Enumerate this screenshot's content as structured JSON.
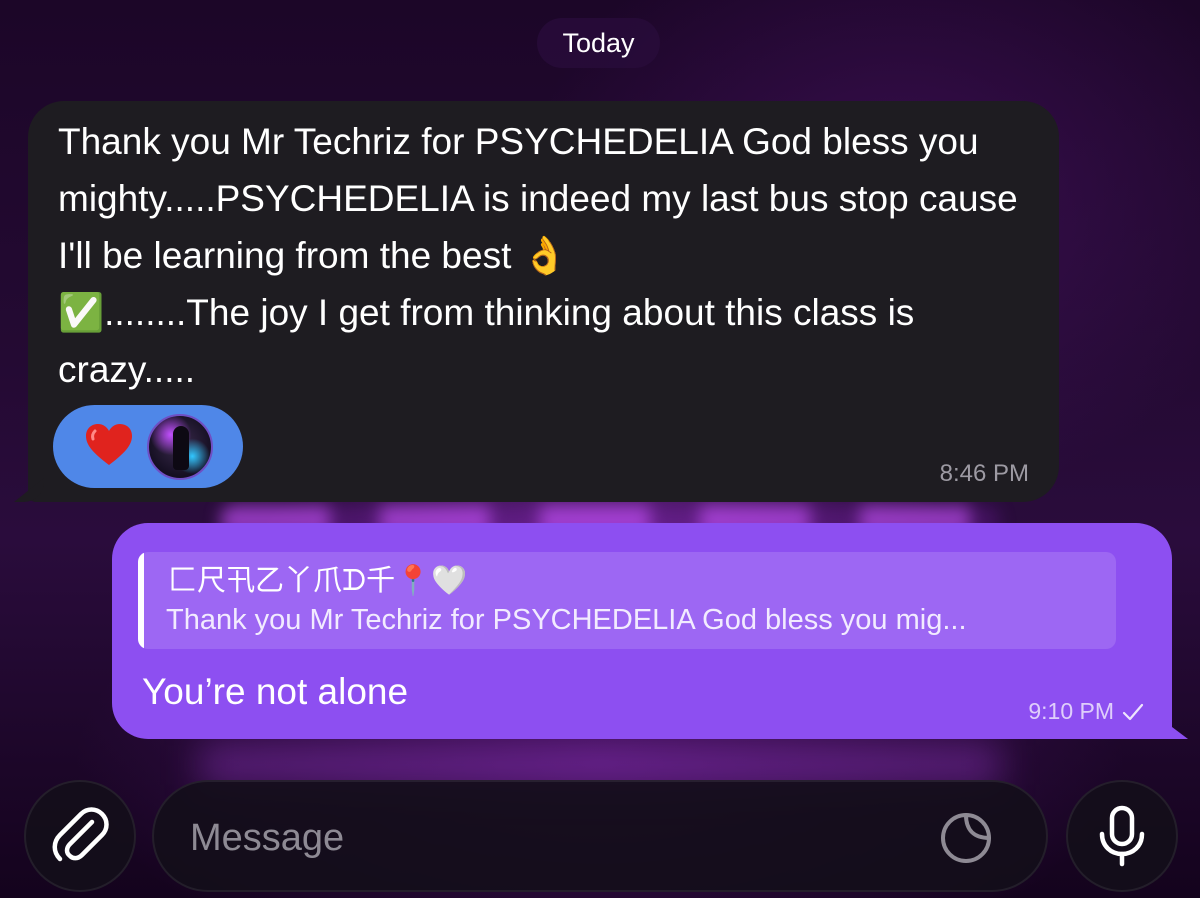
{
  "date_separator": "Today",
  "incoming": {
    "text": "Thank you Mr Techriz for PSYCHEDELIA God bless you mighty.....PSYCHEDELIA is indeed my last bus stop cause I'll be learning from the best 👌\n✅........The joy I get from thinking about this class is crazy.....",
    "reaction_emoji": "❤️",
    "time": "8:46 PM"
  },
  "outgoing": {
    "reply_to_name": "匚尺卂乙丫爪ᗪ千📍🤍",
    "reply_to_text": "Thank you Mr Techriz for PSYCHEDELIA God bless you mig...",
    "text": "You’re not alone",
    "time": "9:10 PM"
  },
  "composer": {
    "placeholder": "Message",
    "value": ""
  },
  "icons": {
    "attach": "paperclip-icon",
    "sticker": "sticker-icon",
    "mic": "microphone-icon",
    "read_status": "check-icon"
  },
  "colors": {
    "incoming_bubble": "#1e1c21",
    "outgoing_bubble": "#8d4ff1",
    "reaction_pill": "#4f87e8"
  }
}
